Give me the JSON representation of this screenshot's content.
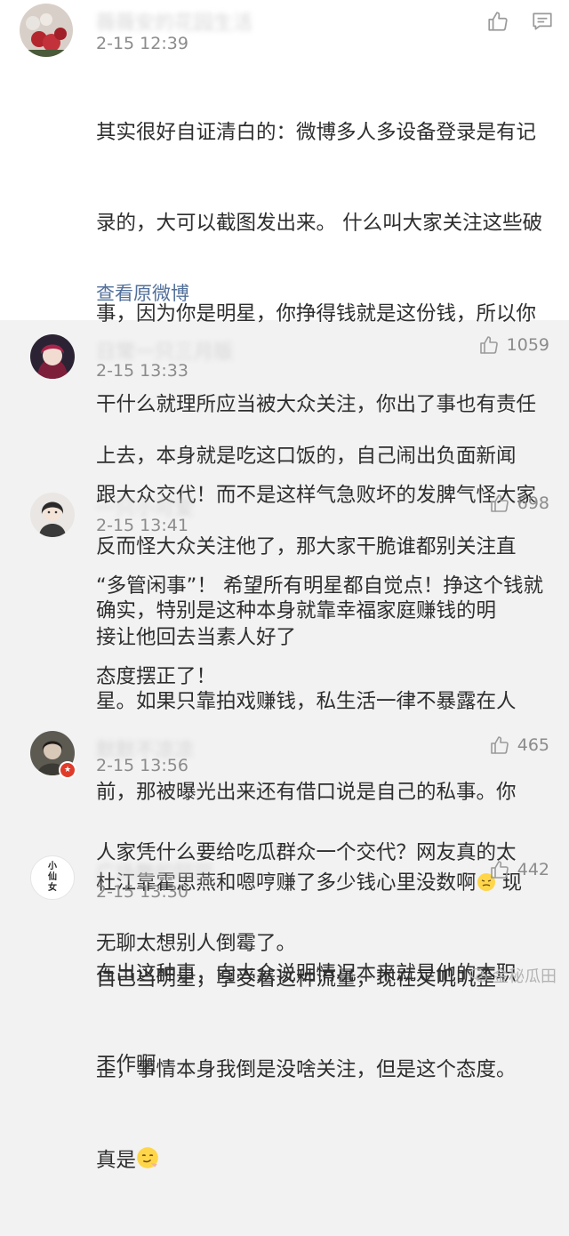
{
  "post": {
    "name": "薇薇安的花园生活",
    "time": "2-15 12:39",
    "content_lines": [
      "其实很好自证清白的：微博多人多设备登录是有记",
      "录的，大可以截图发出来。 什么叫大家关注这些破",
      "事，因为你是明星，你挣得钱就是这份钱，所以你",
      "干什么就理所应当被大众关注，你出了事也有责任",
      "跟大众交代！而不是这样气急败坏的发脾气怪大家",
      "“多管闲事”！ 希望所有明星都自觉点！挣这个钱就",
      "态度摆正了！"
    ],
    "view_original": "查看原微博"
  },
  "comments": [
    {
      "name": "日常一只三月版",
      "time": "2-15 13:33",
      "likes": "1059",
      "lines": [
        "上去，本身就是吃这口饭的，自己闹出负面新闻",
        "反而怪大众关注他了，那大家干脆谁都别关注直",
        "接让他回去当素人好了"
      ]
    },
    {
      "name": "一只小可爱",
      "time": "2-15 13:41",
      "likes": "698",
      "lines": [
        "确实，特别是这种本身就靠幸福家庭赚钱的明",
        "星。如果只靠拍戏赚钱，私生活一律不暴露在人",
        "前，那被曝光出来还有借口说是自己的私事。你",
        "杜江靠霍思燕和嗯哼赚了多少钱心里没数啊",
        "在出这种事，向大众说明情况本来就是他的本职",
        "工作啊"
      ],
      "line4_tail": " 现"
    },
    {
      "name": "默默不凉凉",
      "time": "2-15 13:56",
      "likes": "465",
      "lines": [
        "人家凭什么要给吃瓜群众一个交代？网友真的太",
        "无聊太想别人倒霉了。"
      ]
    },
    {
      "name": "广场舞的阿巴",
      "time": "2-15 13:30",
      "likes": "442",
      "lines": [
        "自己当明星，享受着这种流量，现在又叽叽歪",
        "歪，事情本身我倒是没啥关注，但是这个态度。",
        "真是"
      ],
      "avatar_text": "小\n仙\n女"
    }
  ],
  "watermark": "金秘瓜田",
  "colors": {
    "link": "#52709b",
    "muted": "#8b8b8b",
    "background": "#f2f2f2"
  }
}
